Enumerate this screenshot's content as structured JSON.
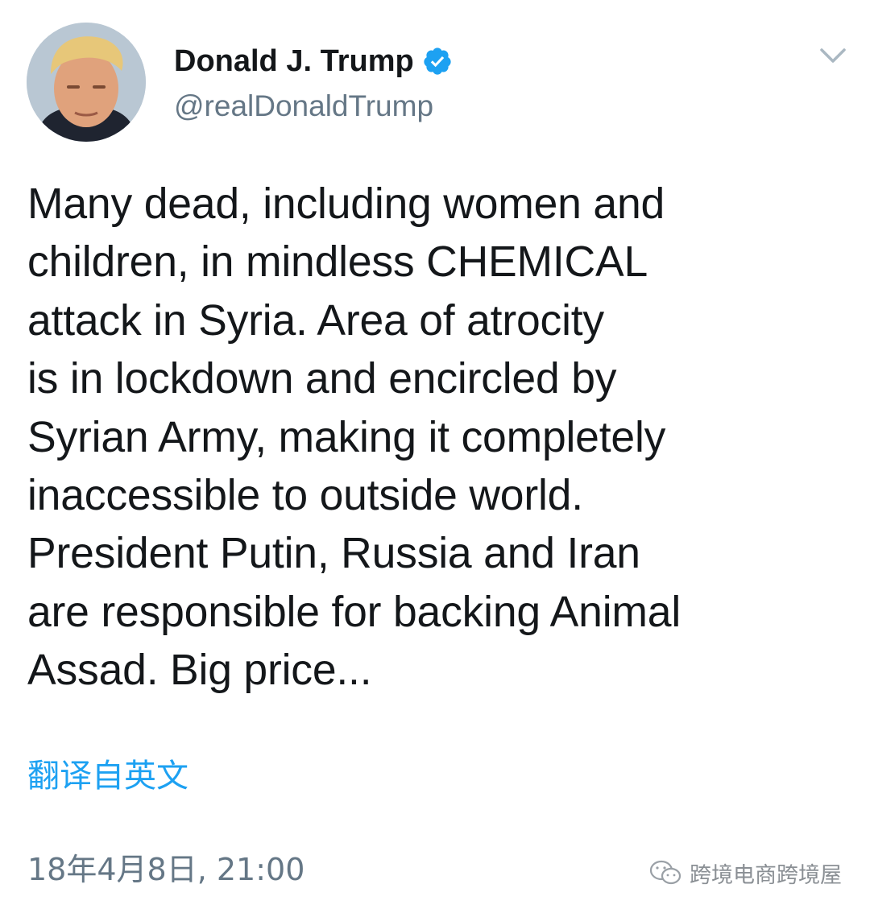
{
  "author": {
    "display_name": "Donald J. Trump",
    "handle": "@realDonaldTrump",
    "verified": true
  },
  "tweet": {
    "text": "Many dead, including women and\nchildren, in mindless CHEMICAL\nattack in Syria. Area of atrocity\nis in lockdown and encircled by\nSyrian Army, making it completely\ninaccessible to outside world.\nPresident Putin, Russia and Iran\nare responsible for backing Animal\nAssad. Big price...",
    "translate_label": "翻译自英文",
    "timestamp": "18年4月8日, 21:00"
  },
  "watermark": {
    "text": "跨境电商跨境屋"
  },
  "icons": {
    "verified": "verified-badge-icon",
    "caret": "chevron-down-icon",
    "watermark": "wechat-icon"
  },
  "colors": {
    "link": "#1da1f2",
    "verified": "#1da1f2",
    "secondary_text": "#657786",
    "primary_text": "#14171a"
  }
}
